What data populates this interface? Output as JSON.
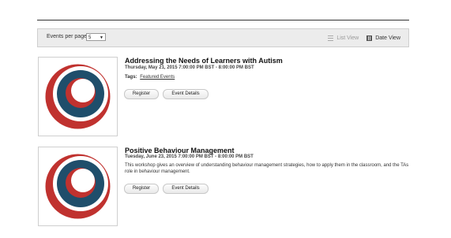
{
  "toolbar": {
    "events_per_page_label": "Events per page",
    "events_per_page_value": "5",
    "list_view_label": "List View",
    "date_view_label": "Date View"
  },
  "logo_colors": {
    "outer": "#c0322f",
    "ring": "#1f4e6b",
    "inner": "#c0322f"
  },
  "events": [
    {
      "title": "Addressing the Needs of Learners with Autism",
      "date": "Thursday, May 21, 2015 7:00:00 PM BST - 8:00:00 PM BST",
      "tags_label": "Tags:",
      "tag": "Featured Events",
      "register_label": "Register",
      "details_label": "Event Details"
    },
    {
      "title": "Positive Behaviour Management",
      "date": "Tuesday, June 23, 2015 7:00:00 PM BST - 8:00:00 PM BST",
      "description": "This workshop gives an overview of understanding behaviour management strategies, how to apply them in the classroom, and the TAs role in behaviour management.",
      "register_label": "Register",
      "details_label": "Event Details"
    }
  ]
}
